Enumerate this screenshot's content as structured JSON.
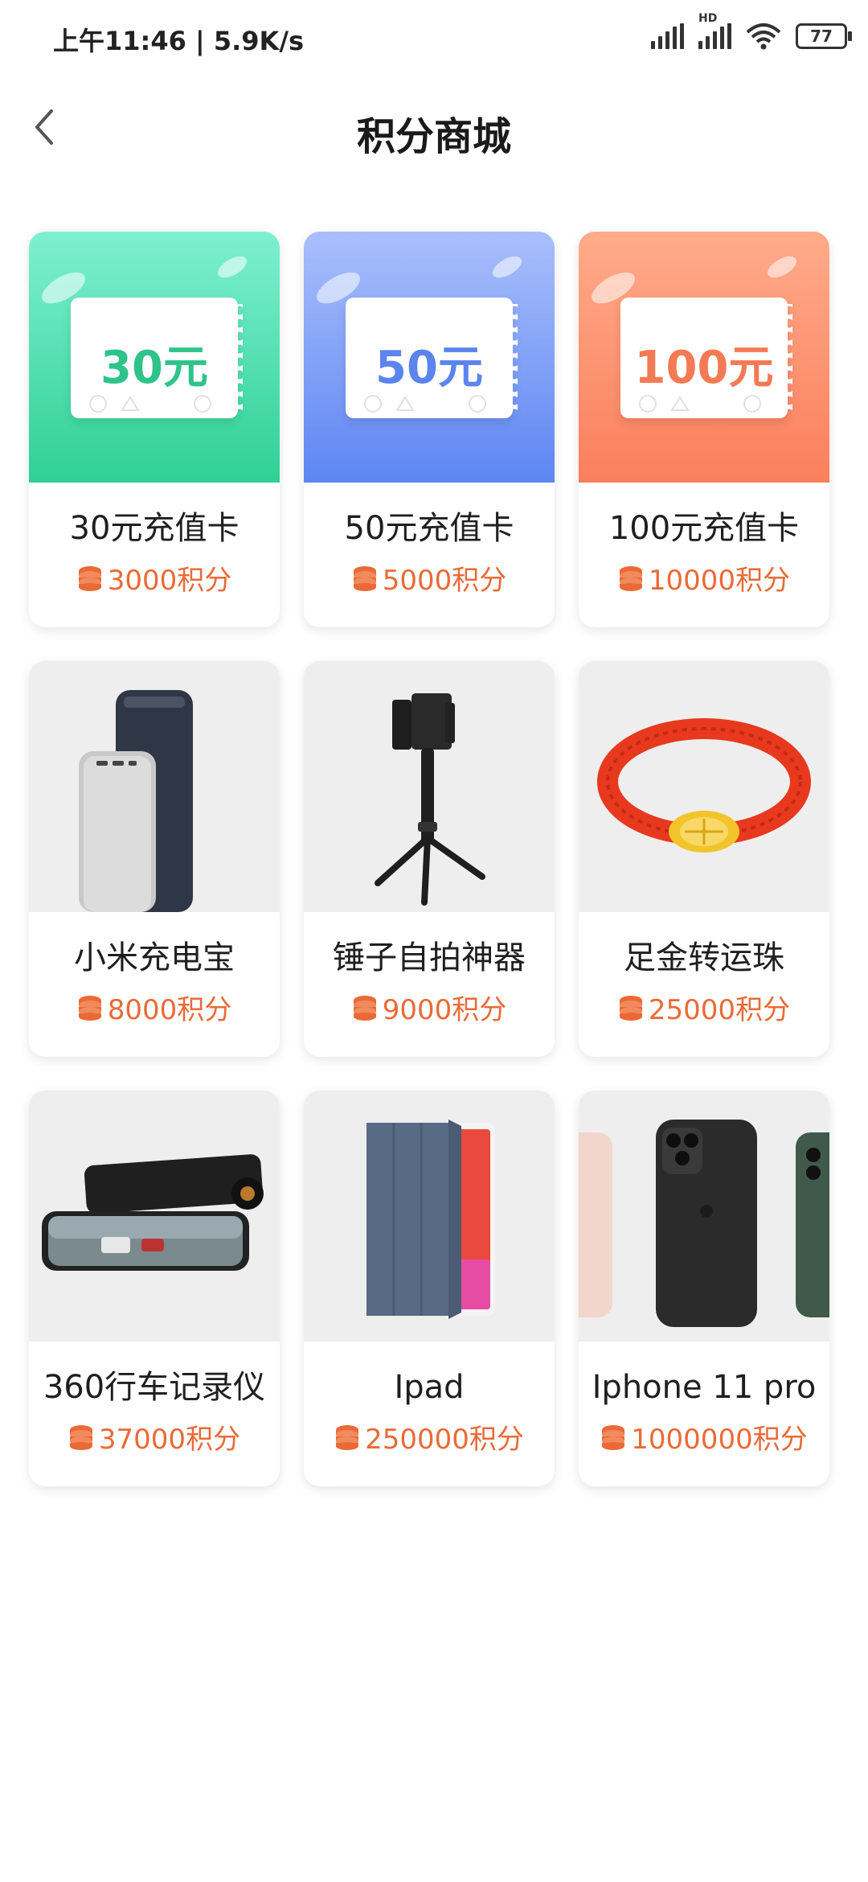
{
  "status": {
    "time": "上午11:46 | 5.9K/s",
    "battery": "77",
    "network_label": "HD"
  },
  "header": {
    "title": "积分商城"
  },
  "products": [
    {
      "name": "30元充值卡",
      "points": "3000积分",
      "voucher": "30元",
      "voucher_color": "#2fc38a",
      "icon": "voucher-card"
    },
    {
      "name": "50元充值卡",
      "points": "5000积分",
      "voucher": "50元",
      "voucher_color": "#5b84ee",
      "icon": "voucher-card"
    },
    {
      "name": "100元充值卡",
      "points": "10000积分",
      "voucher": "100元",
      "voucher_color": "#f47a55",
      "icon": "voucher-card"
    },
    {
      "name": "小米充电宝",
      "points": "8000积分",
      "icon": "power-bank"
    },
    {
      "name": "锤子自拍神器",
      "points": "9000积分",
      "icon": "selfie-stick"
    },
    {
      "name": "足金转运珠",
      "points": "25000积分",
      "icon": "gold-bracelet"
    },
    {
      "name": "360行车记录仪",
      "points": "37000积分",
      "icon": "dash-cam"
    },
    {
      "name": "Ipad",
      "points": "250000积分",
      "icon": "ipad"
    },
    {
      "name": "Iphone 11 pro",
      "points": "1000000积分",
      "icon": "iphone"
    }
  ],
  "colors": {
    "price": "#ea6a37",
    "green": "#2fd096",
    "blue": "#5e86f2",
    "orange": "#fb7f5d"
  }
}
